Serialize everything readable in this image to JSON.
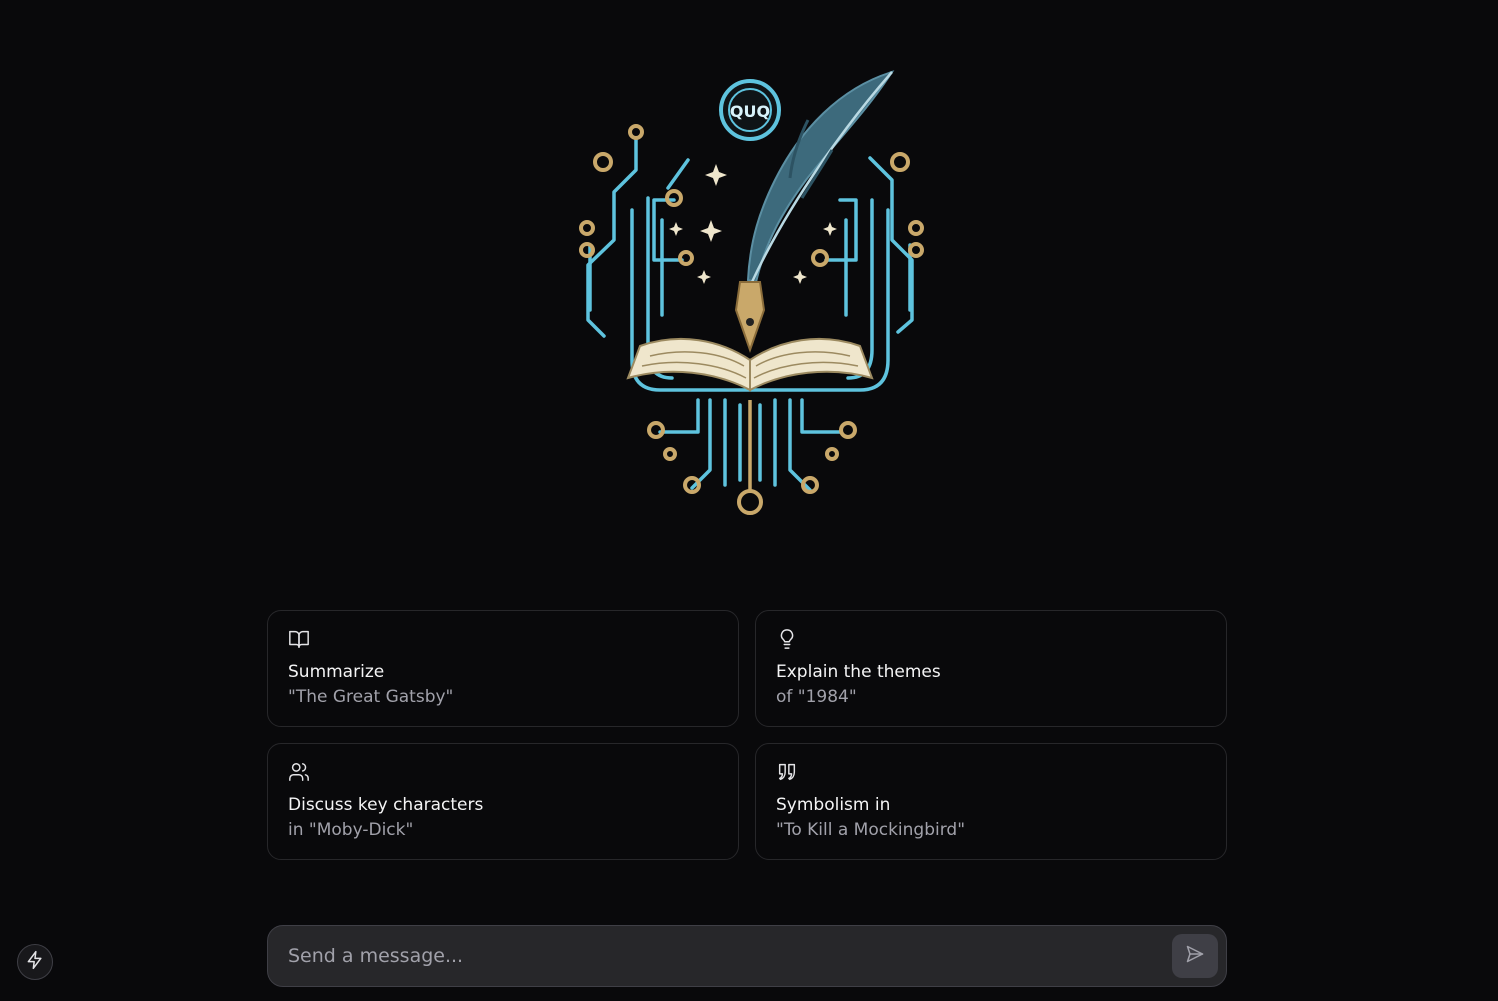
{
  "logo": {
    "badge_text": "QUQ"
  },
  "suggestions": [
    {
      "icon": "book-open-icon",
      "title": "Summarize",
      "subtitle": "\"The Great Gatsby\""
    },
    {
      "icon": "lightbulb-icon",
      "title": "Explain the themes",
      "subtitle": "of \"1984\""
    },
    {
      "icon": "users-icon",
      "title": "Discuss key characters",
      "subtitle": "in \"Moby-Dick\""
    },
    {
      "icon": "quote-icon",
      "title": "Symbolism in",
      "subtitle": "\"To Kill a Mockingbird\""
    }
  ],
  "composer": {
    "placeholder": "Send a message...",
    "send_icon": "send-icon"
  },
  "corner_button": {
    "icon": "bolt-icon"
  },
  "colors": {
    "background": "#09090b",
    "circuit_blue": "#5ec3de",
    "gold": "#c9a86a",
    "cream": "#efe6cc",
    "quill": "#3d6a7c"
  }
}
